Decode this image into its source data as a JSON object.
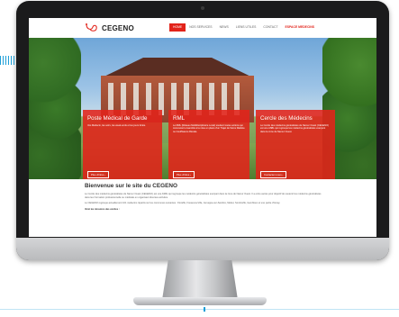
{
  "site": {
    "logo_text": "CEGENO",
    "nav": [
      {
        "label": "HOME"
      },
      {
        "label": "NOS SERVICES"
      },
      {
        "label": "NEWS"
      },
      {
        "label": "LIENS UTILES"
      },
      {
        "label": "CONTACT"
      },
      {
        "label": "ESPACE MEDECINS"
      }
    ]
  },
  "hero": {
    "cards": [
      {
        "title": "Poste Médical de Garde",
        "text": "Vos Médecin, les soirs, les week-ends et les jours fériés.",
        "button": "Plus d'infos ›"
      },
      {
        "title": "RML",
        "text": "Le RML (Réseau Multidisciplinaire Local) soutient toutes actions qui concourent ensemble à la mise en place d'un Trajet de Soins Diabète ou Insuffisance Rénale.",
        "button": "Plus d'infos ›"
      },
      {
        "title": "Cercle des Médecins",
        "text": "Le Cercle des médecins généralistes de Namur Ouest (CEGENO) est une ASBL qui regroupe les médecins généralistes exerçant dans la zone de Namur Ouest.",
        "button": "Contactez-nous ›"
      }
    ]
  },
  "content": {
    "welcome": "Bienvenue sur le site du CEGENO",
    "paragraph1": "Le Cercle des médecins généralistes de Namur Ouest (CEGENO) est une ASBL qui regroupe les médecins généralistes exerçant dans la zone de Namur Ouest. Il a entre autres pour objectif de soutenir les médecins généralistes dans leur formation professionnelle ou médicale en organisant diverses activités.",
    "paragraph2": "Le CEGENO regroupe actuellement 101 médecins répartis sur les communes suivantes : Floreffe, Fosses-la-Ville, Jemeppe-sur-Sambre, Mettet, Sombreffe, Gembloux et une partie d'Amay.",
    "section_label": "Voici les missions des cercles :"
  },
  "colors": {
    "brand_red": "#e2231a",
    "monitor": "#1b1b1c"
  }
}
